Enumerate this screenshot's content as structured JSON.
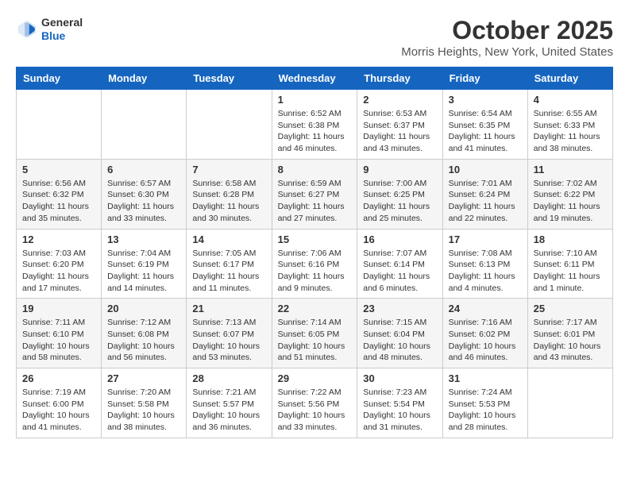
{
  "header": {
    "logo": {
      "general": "General",
      "blue": "Blue"
    },
    "title": "October 2025",
    "location": "Morris Heights, New York, United States"
  },
  "weekdays": [
    "Sunday",
    "Monday",
    "Tuesday",
    "Wednesday",
    "Thursday",
    "Friday",
    "Saturday"
  ],
  "weeks": [
    [
      {
        "day": "",
        "info": ""
      },
      {
        "day": "",
        "info": ""
      },
      {
        "day": "",
        "info": ""
      },
      {
        "day": "1",
        "info": "Sunrise: 6:52 AM\nSunset: 6:38 PM\nDaylight: 11 hours and 46 minutes."
      },
      {
        "day": "2",
        "info": "Sunrise: 6:53 AM\nSunset: 6:37 PM\nDaylight: 11 hours and 43 minutes."
      },
      {
        "day": "3",
        "info": "Sunrise: 6:54 AM\nSunset: 6:35 PM\nDaylight: 11 hours and 41 minutes."
      },
      {
        "day": "4",
        "info": "Sunrise: 6:55 AM\nSunset: 6:33 PM\nDaylight: 11 hours and 38 minutes."
      }
    ],
    [
      {
        "day": "5",
        "info": "Sunrise: 6:56 AM\nSunset: 6:32 PM\nDaylight: 11 hours and 35 minutes."
      },
      {
        "day": "6",
        "info": "Sunrise: 6:57 AM\nSunset: 6:30 PM\nDaylight: 11 hours and 33 minutes."
      },
      {
        "day": "7",
        "info": "Sunrise: 6:58 AM\nSunset: 6:28 PM\nDaylight: 11 hours and 30 minutes."
      },
      {
        "day": "8",
        "info": "Sunrise: 6:59 AM\nSunset: 6:27 PM\nDaylight: 11 hours and 27 minutes."
      },
      {
        "day": "9",
        "info": "Sunrise: 7:00 AM\nSunset: 6:25 PM\nDaylight: 11 hours and 25 minutes."
      },
      {
        "day": "10",
        "info": "Sunrise: 7:01 AM\nSunset: 6:24 PM\nDaylight: 11 hours and 22 minutes."
      },
      {
        "day": "11",
        "info": "Sunrise: 7:02 AM\nSunset: 6:22 PM\nDaylight: 11 hours and 19 minutes."
      }
    ],
    [
      {
        "day": "12",
        "info": "Sunrise: 7:03 AM\nSunset: 6:20 PM\nDaylight: 11 hours and 17 minutes."
      },
      {
        "day": "13",
        "info": "Sunrise: 7:04 AM\nSunset: 6:19 PM\nDaylight: 11 hours and 14 minutes."
      },
      {
        "day": "14",
        "info": "Sunrise: 7:05 AM\nSunset: 6:17 PM\nDaylight: 11 hours and 11 minutes."
      },
      {
        "day": "15",
        "info": "Sunrise: 7:06 AM\nSunset: 6:16 PM\nDaylight: 11 hours and 9 minutes."
      },
      {
        "day": "16",
        "info": "Sunrise: 7:07 AM\nSunset: 6:14 PM\nDaylight: 11 hours and 6 minutes."
      },
      {
        "day": "17",
        "info": "Sunrise: 7:08 AM\nSunset: 6:13 PM\nDaylight: 11 hours and 4 minutes."
      },
      {
        "day": "18",
        "info": "Sunrise: 7:10 AM\nSunset: 6:11 PM\nDaylight: 11 hours and 1 minute."
      }
    ],
    [
      {
        "day": "19",
        "info": "Sunrise: 7:11 AM\nSunset: 6:10 PM\nDaylight: 10 hours and 58 minutes."
      },
      {
        "day": "20",
        "info": "Sunrise: 7:12 AM\nSunset: 6:08 PM\nDaylight: 10 hours and 56 minutes."
      },
      {
        "day": "21",
        "info": "Sunrise: 7:13 AM\nSunset: 6:07 PM\nDaylight: 10 hours and 53 minutes."
      },
      {
        "day": "22",
        "info": "Sunrise: 7:14 AM\nSunset: 6:05 PM\nDaylight: 10 hours and 51 minutes."
      },
      {
        "day": "23",
        "info": "Sunrise: 7:15 AM\nSunset: 6:04 PM\nDaylight: 10 hours and 48 minutes."
      },
      {
        "day": "24",
        "info": "Sunrise: 7:16 AM\nSunset: 6:02 PM\nDaylight: 10 hours and 46 minutes."
      },
      {
        "day": "25",
        "info": "Sunrise: 7:17 AM\nSunset: 6:01 PM\nDaylight: 10 hours and 43 minutes."
      }
    ],
    [
      {
        "day": "26",
        "info": "Sunrise: 7:19 AM\nSunset: 6:00 PM\nDaylight: 10 hours and 41 minutes."
      },
      {
        "day": "27",
        "info": "Sunrise: 7:20 AM\nSunset: 5:58 PM\nDaylight: 10 hours and 38 minutes."
      },
      {
        "day": "28",
        "info": "Sunrise: 7:21 AM\nSunset: 5:57 PM\nDaylight: 10 hours and 36 minutes."
      },
      {
        "day": "29",
        "info": "Sunrise: 7:22 AM\nSunset: 5:56 PM\nDaylight: 10 hours and 33 minutes."
      },
      {
        "day": "30",
        "info": "Sunrise: 7:23 AM\nSunset: 5:54 PM\nDaylight: 10 hours and 31 minutes."
      },
      {
        "day": "31",
        "info": "Sunrise: 7:24 AM\nSunset: 5:53 PM\nDaylight: 10 hours and 28 minutes."
      },
      {
        "day": "",
        "info": ""
      }
    ]
  ]
}
